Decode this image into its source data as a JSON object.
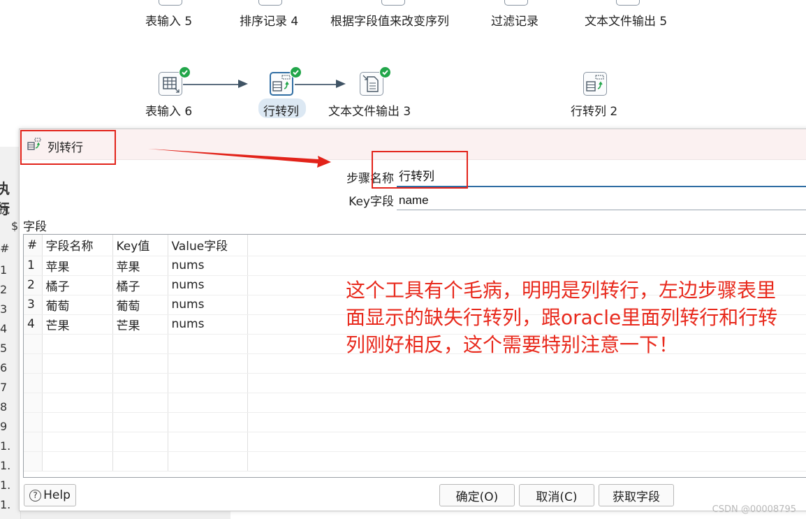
{
  "canvas": {
    "top_row": [
      "表输入 5",
      "排序记录 4",
      "根据字段值来改变序列",
      "过滤记录",
      "文本文件输出 5"
    ],
    "steps": [
      {
        "label": "表输入 6",
        "status": "ok"
      },
      {
        "label": "行转列",
        "status": "ok"
      },
      {
        "label": "文本文件输出 3",
        "status": "ok"
      },
      {
        "label": "行转列 2"
      }
    ]
  },
  "background": {
    "left_fragments": [
      "执行",
      "执",
      "$",
      "#",
      "1",
      "2",
      "3",
      "4",
      "5",
      "6",
      "7",
      "8",
      "9",
      "1.",
      "1.",
      "1.",
      "1."
    ]
  },
  "dialog": {
    "title": "列转行",
    "step_name_label": "步骤名称",
    "step_name_value": "行转列",
    "key_field_label": "Key字段",
    "key_field_value": "name",
    "fields_section_label": "字段",
    "table": {
      "headers": [
        "#",
        "字段名称",
        "Key值",
        "Value字段"
      ],
      "rows": [
        [
          "1",
          "苹果",
          "苹果",
          "nums"
        ],
        [
          "2",
          "橘子",
          "橘子",
          "nums"
        ],
        [
          "3",
          "葡萄",
          "葡萄",
          "nums"
        ],
        [
          "4",
          "芒果",
          "芒果",
          "nums"
        ]
      ]
    },
    "buttons": {
      "help": "Help",
      "ok": "确定(O)",
      "cancel": "取消(C)",
      "get_fields": "获取字段"
    }
  },
  "annotation": {
    "text": "这个工具有个毛病，明明是列转行，左边步骤表里面显示的缺失行转列，跟oracle里面列转行和行转列刚好相反，这个需要特别注意一下！"
  },
  "watermark": "CSDN @00008795",
  "colors": {
    "annotation_red": "#e8291c",
    "selection_blue": "#2f6da3",
    "ok_green": "#22a64a",
    "dialog_title_bg": "#fbf1f1"
  }
}
